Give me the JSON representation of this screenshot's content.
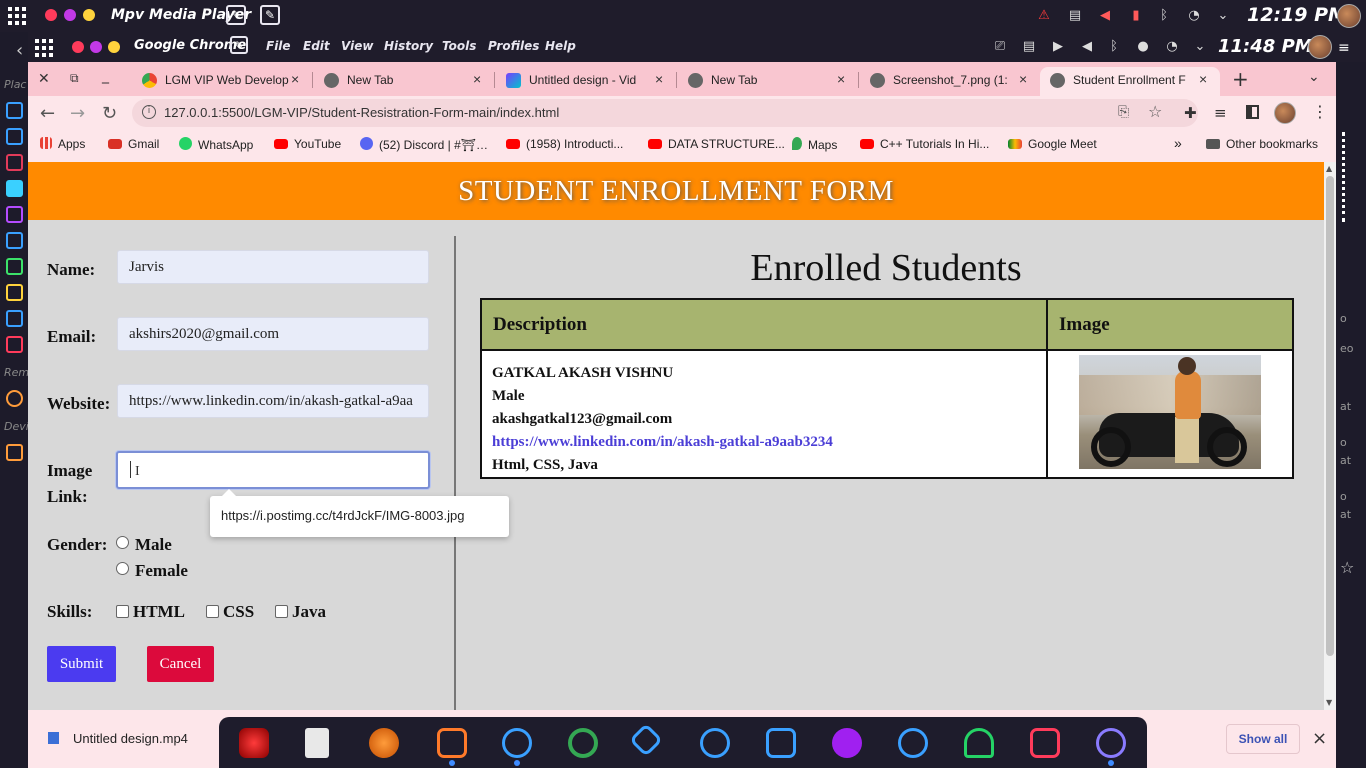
{
  "topbar": {
    "app_title": "Mpv Media Player",
    "clock": "12:19 PM"
  },
  "chrome": {
    "app_title": "Google Chrome",
    "menu": [
      "File",
      "Edit",
      "View",
      "History",
      "Tools",
      "Profiles",
      "Help"
    ],
    "clock": "11:48 PM"
  },
  "left_dock_labels": [
    "Plac",
    "Rem",
    "Devi"
  ],
  "right_side_labels": [
    "o",
    "eo",
    "at",
    "o",
    "at",
    "o",
    "at"
  ],
  "tabs": [
    {
      "label": "LGM VIP Web Develop",
      "close": "×"
    },
    {
      "label": "New Tab",
      "close": "×"
    },
    {
      "label": "Untitled design - Vid",
      "close": "×"
    },
    {
      "label": "New Tab",
      "close": "×"
    },
    {
      "label": "Screenshot_7.png (1:",
      "close": "×"
    },
    {
      "label": "Student Enrollment F",
      "close": "×"
    }
  ],
  "address": {
    "url": "127.0.0.1:5500/LGM-VIP/Student-Resistration-Form-main/index.html"
  },
  "bookmarks": [
    "Apps",
    "Gmail",
    "WhatsApp",
    "YouTube",
    "(52) Discord | #⛩…",
    "(1958) Introducti...",
    "DATA STRUCTURE...",
    "Maps",
    "C++ Tutorials In Hi...",
    "Google Meet"
  ],
  "bookmarks_more": "»",
  "other_bookmarks": "Other bookmarks",
  "page": {
    "header": "STUDENT ENROLLMENT FORM",
    "form": {
      "name_label": "Name:",
      "name_value": "Jarvis",
      "email_label": "Email:",
      "email_value": "akshirs2020@gmail.com",
      "website_label": "Website:",
      "website_value": "https://www.linkedin.com/in/akash-gatkal-a9aa",
      "image_label_1": "Image",
      "image_label_2": "Link:",
      "gender_label": "Gender:",
      "gender_options": [
        "Male",
        "Female"
      ],
      "skills_label": "Skills:",
      "skills_options": [
        "HTML",
        "CSS",
        "Java"
      ],
      "submit": "Submit",
      "cancel": "Cancel",
      "autocomplete": "https://i.postimg.cc/t4rdJckF/IMG-8003.jpg"
    },
    "enrolled": {
      "title": "Enrolled Students",
      "headers": [
        "Description",
        "Image"
      ],
      "rows": [
        {
          "name": "GATKAL AKASH VISHNU",
          "gender": "Male",
          "email": "akashgatkal123@gmail.com",
          "website": "https://www.linkedin.com/in/akash-gatkal-a9aab3234",
          "skills": "Html, CSS, Java"
        }
      ]
    }
  },
  "downloads": {
    "file": "Untitled design.mp4",
    "show_all": "Show all",
    "close": "×"
  },
  "colors": {
    "header_orange": "#ff8a00",
    "table_header": "#a7b46f",
    "submit": "#4b3bf0",
    "cancel": "#dc0a3c",
    "tab_strip": "#f9c6d0"
  }
}
